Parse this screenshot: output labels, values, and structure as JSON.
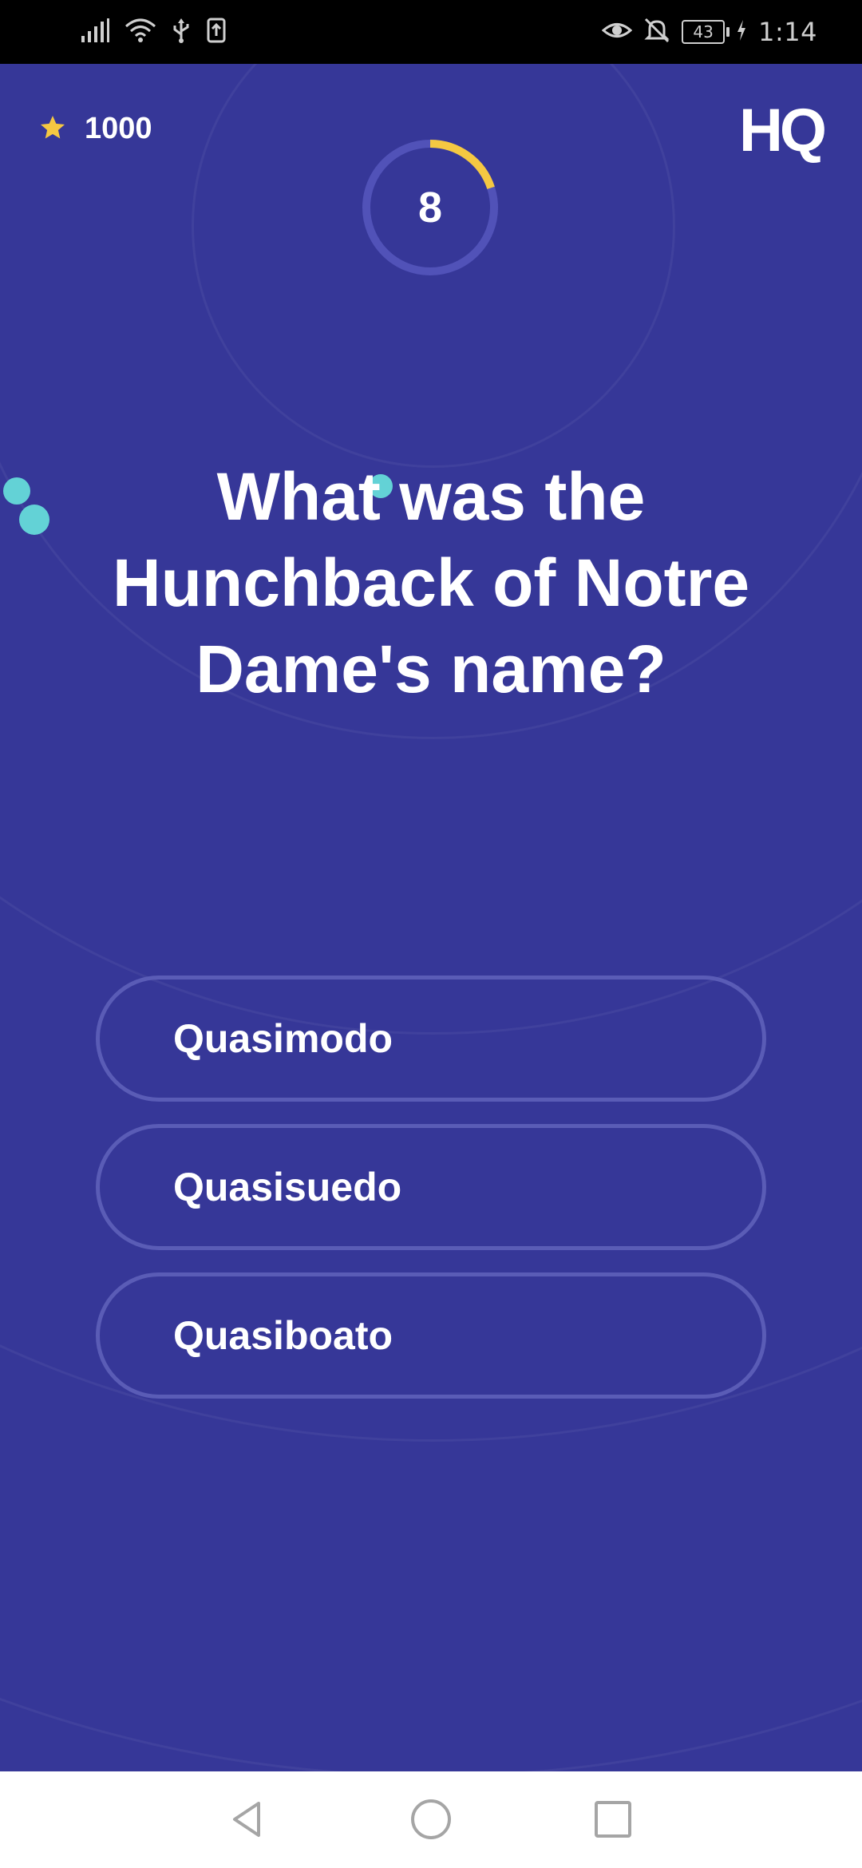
{
  "status_bar": {
    "time": "1:14",
    "battery": "43",
    "left_icons": [
      "signal-icon",
      "wifi-icon",
      "usb-icon",
      "upload-icon"
    ],
    "right_icons": [
      "eye-icon",
      "bell-off-icon",
      "battery-icon",
      "charging-icon"
    ]
  },
  "game": {
    "score": "1000",
    "timer": {
      "value": "8",
      "progress": 0.2
    },
    "logo": "HQ",
    "question": "What was the Hunchback of Notre Dame's name?",
    "answers": [
      {
        "label": "Quasimodo"
      },
      {
        "label": "Quasisuedo"
      },
      {
        "label": "Quasiboato"
      }
    ]
  },
  "colors": {
    "background": "#363798",
    "accent": "#f5c842",
    "button_border": "#5a5cb6",
    "dot": "#63d2d6"
  },
  "nav_bar": {
    "buttons": [
      "back-icon",
      "home-icon",
      "recents-icon"
    ]
  }
}
